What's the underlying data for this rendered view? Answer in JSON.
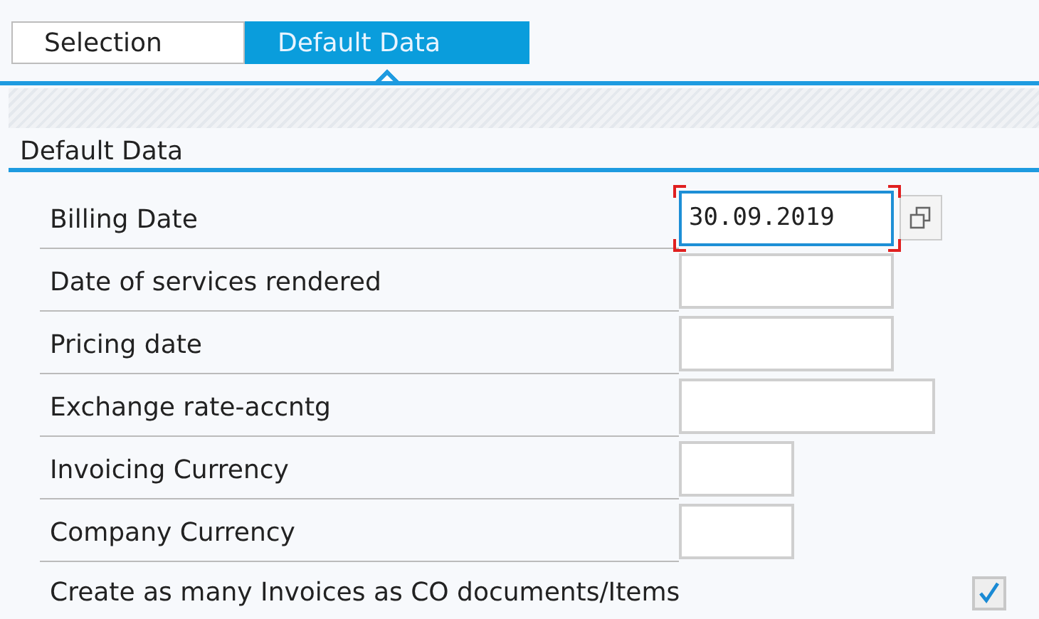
{
  "tabs": [
    {
      "label": "Selection",
      "selected": false
    },
    {
      "label": "Default Data",
      "selected": true
    }
  ],
  "section": {
    "title": "Default Data"
  },
  "fields": [
    {
      "kind": "input",
      "label": "Billing Date",
      "value": "30.09.2019",
      "focused": true
    },
    {
      "kind": "input",
      "label": "Date of services rendered",
      "focused": false
    },
    {
      "kind": "input",
      "label": "Pricing date",
      "focused": false
    },
    {
      "kind": "input",
      "label": "Exchange rate-accntg",
      "focused": false
    },
    {
      "kind": "input",
      "label": "Invoicing Currency",
      "focused": false
    },
    {
      "kind": "input",
      "label": "Company Currency",
      "focused": false
    },
    {
      "kind": "checkbox",
      "label": "Create as many Invoices as CO documents/Items",
      "checked": true
    }
  ]
}
